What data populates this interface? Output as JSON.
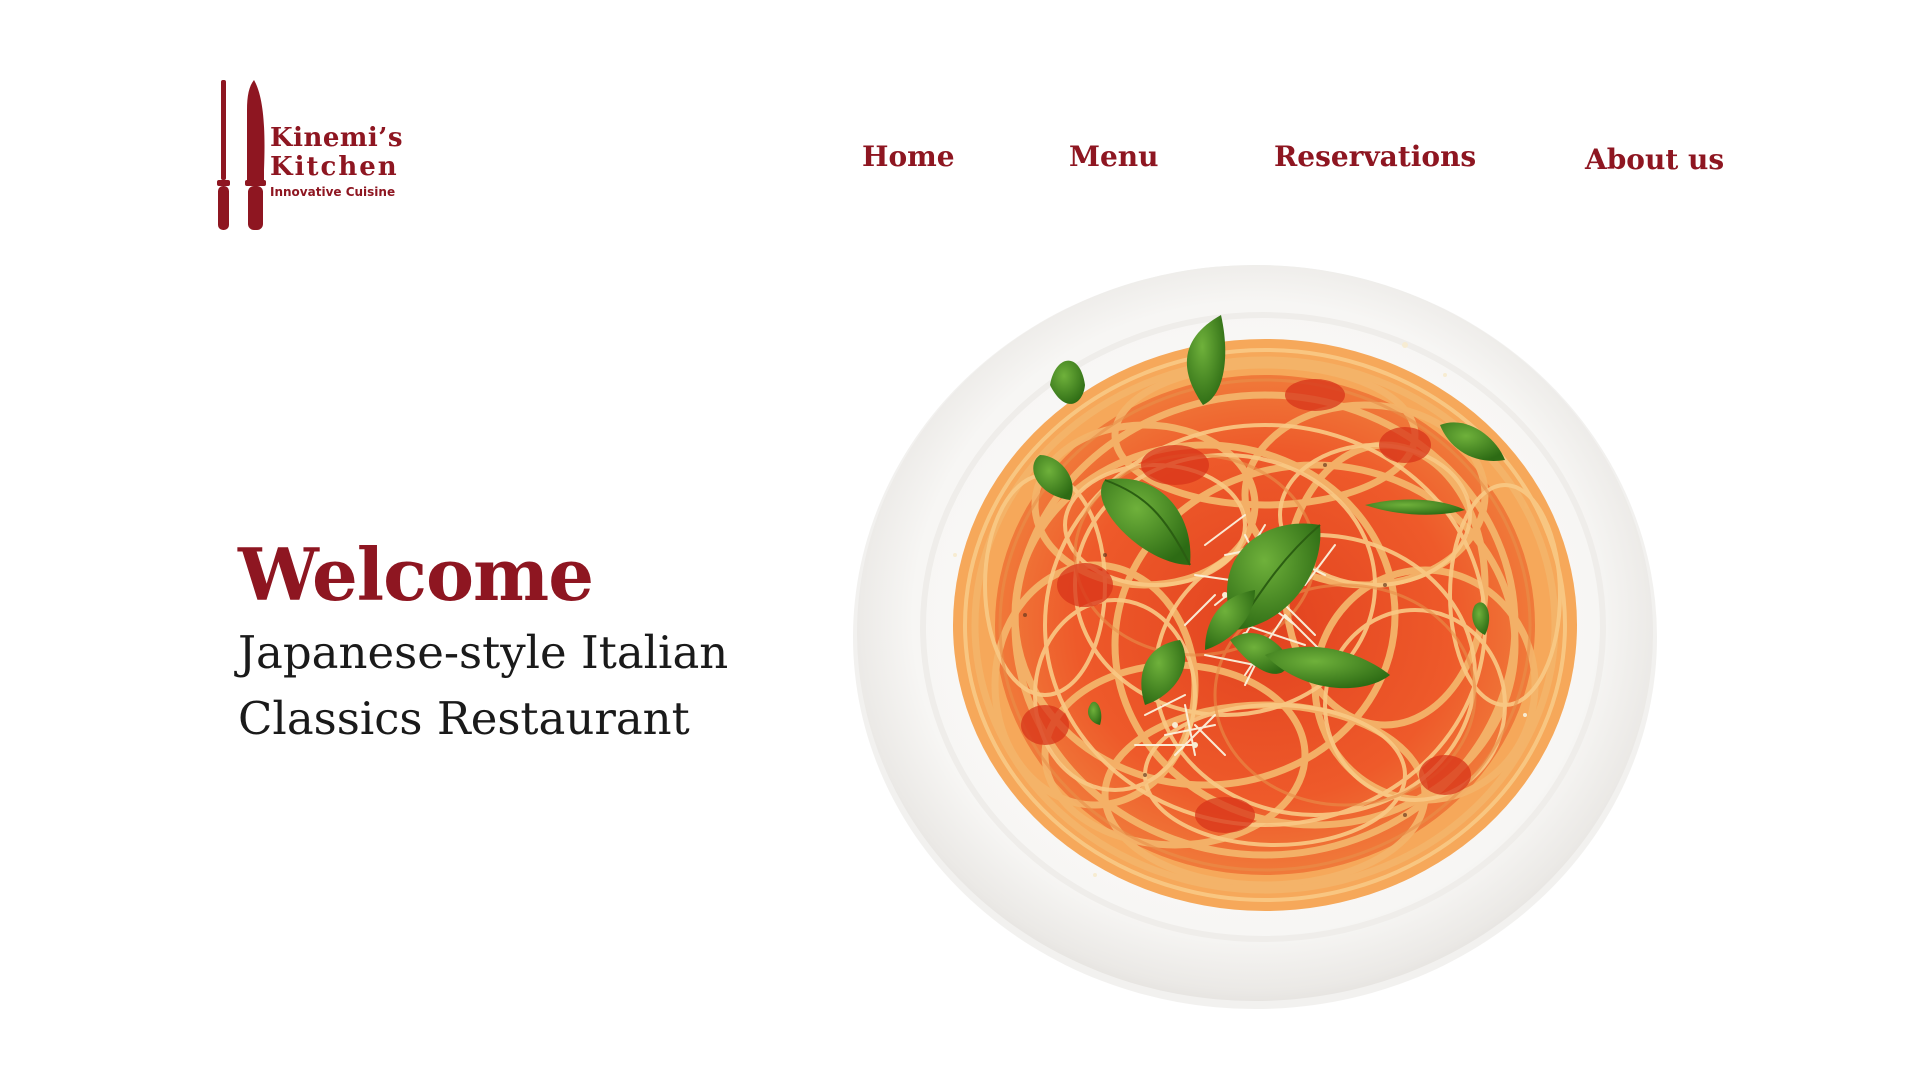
{
  "logo": {
    "name_line1": "Kinemi’s",
    "name_line2": "Kitchen",
    "tagline": "Innovative Cuisine"
  },
  "nav": {
    "items": [
      {
        "label": "Home"
      },
      {
        "label": "Menu"
      },
      {
        "label": "Reservations"
      },
      {
        "label": "About us"
      }
    ]
  },
  "hero": {
    "title": "Welcome",
    "subtitle": "Japanese-style Italian Classics Restaurant"
  },
  "colors": {
    "brand": "#8e1621",
    "text": "#1a1a1a",
    "background": "#ffffff"
  },
  "icons": {
    "logo_mark": "knife-and-fork-icon",
    "hero_image": "spaghetti-plate-image"
  }
}
